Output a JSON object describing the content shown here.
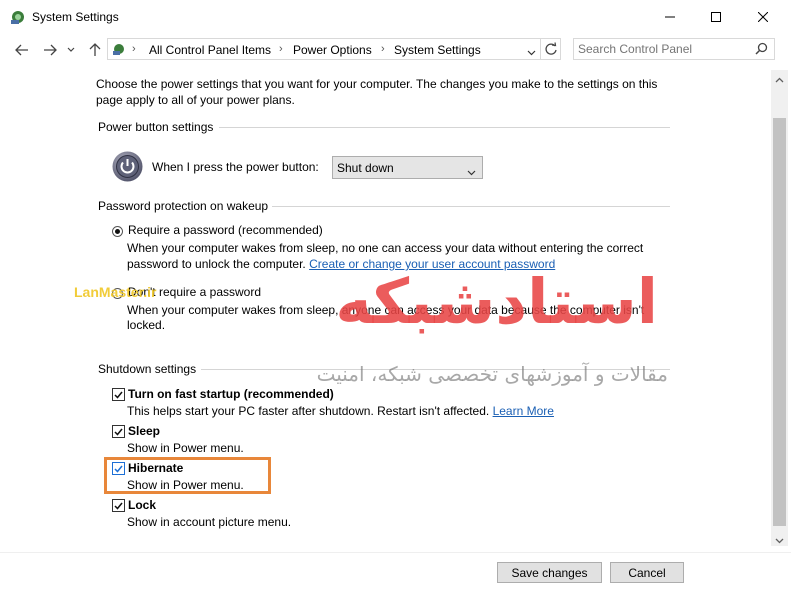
{
  "window": {
    "title": "System Settings",
    "colors": {
      "accent_link": "#1a5fb4",
      "highlight": "#e8873a"
    }
  },
  "address": {
    "crumbs": [
      "All Control Panel Items",
      "Power Options",
      "System Settings"
    ]
  },
  "search": {
    "placeholder": "Search Control Panel"
  },
  "content": {
    "intro_line1": "Choose the power settings that you want for your computer. The changes you make to the settings on this",
    "intro_line2": "page apply to all of your power plans.",
    "power_button": {
      "section_title": "Power button settings",
      "label": "When I press the power button:",
      "selected": "Shut down"
    },
    "password": {
      "section_title": "Password protection on wakeup",
      "require_label": "Require a password (recommended)",
      "require_desc1": "When your computer wakes from sleep, no one can access your data without entering the correct",
      "require_desc2": "password to unlock the computer.",
      "require_link": "Create or change your user account password",
      "norequire_label": "Don't require a password",
      "norequire_desc1": "When your computer wakes from sleep, anyone can access your data because the computer isn't",
      "norequire_desc2": "locked."
    },
    "shutdown": {
      "section_title": "Shutdown settings",
      "fast_label": "Turn on fast startup (recommended)",
      "fast_desc": "This helps start your PC faster after shutdown. Restart isn't affected.",
      "fast_link": "Learn More",
      "sleep_label": "Sleep",
      "sleep_desc": "Show in Power menu.",
      "hibernate_label": "Hibernate",
      "hibernate_desc": "Show in Power menu.",
      "lock_label": "Lock",
      "lock_desc": "Show in account picture menu."
    }
  },
  "footer": {
    "save_label": "Save changes",
    "cancel_label": "Cancel"
  },
  "watermark": {
    "main": "استادشبکه",
    "sub": "مقالات و آموزشهای تخصصی شبکه، امنیت",
    "brand": "LanMaster.ir"
  }
}
